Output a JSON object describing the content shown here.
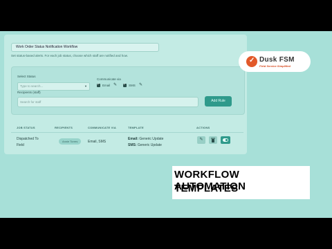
{
  "workflow": {
    "name_value": "Work Order Status Notification Workflow",
    "description": "Set status-based alerts. For each job status, choose which staff are notified and how."
  },
  "rule_form": {
    "status_label": "Select Status",
    "status_placeholder": "Type to search...",
    "communicate_label": "Communicate via",
    "channels": [
      {
        "label": "Email",
        "checked": true
      },
      {
        "label": "SMS",
        "checked": true
      }
    ],
    "recipients_label": "Recipients (staff)",
    "recipients_placeholder": "Search for staff",
    "add_rule_label": "Add Rule"
  },
  "table": {
    "headers": [
      "JOB STATUS",
      "RECIPIENTS",
      "COMMUNICATE VIA",
      "TEMPLATE",
      "ACTIONS"
    ],
    "rows": [
      {
        "job_status_line1": "Dispatched To",
        "job_status_line2": "Field",
        "recipient": "Annie Torres",
        "communicate_via": "Email, SMS",
        "template_email_key": "Email:",
        "template_email_value": "Generic Update",
        "template_sms_key": "SMS:",
        "template_sms_value": "Generic Update"
      }
    ]
  },
  "logo": {
    "title": "Dusk FSM",
    "subtitle": "Field Service Simplified"
  },
  "overlay_title": {
    "line1": "WORKFLOW AUTOMATION",
    "line2": "TEMPLATES"
  },
  "colors": {
    "background": "#a7e0d8",
    "accent": "#2f9a8b",
    "logo_orange": "#e2592a"
  },
  "icons": [
    "pencil-icon",
    "trash-icon",
    "toggle-icon",
    "checkmark-icon",
    "caret-down-icon"
  ]
}
